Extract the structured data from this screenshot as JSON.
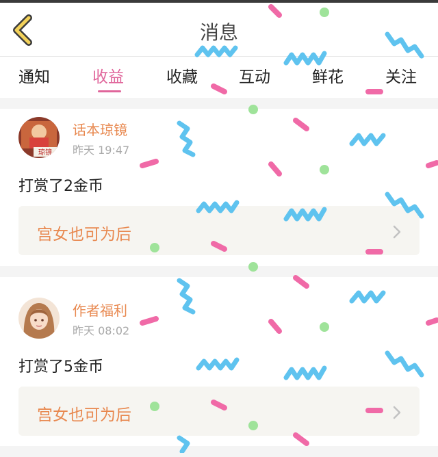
{
  "header": {
    "title": "消息"
  },
  "tabs": [
    {
      "label": "通知",
      "active": false
    },
    {
      "label": "收益",
      "active": true
    },
    {
      "label": "收藏",
      "active": false
    },
    {
      "label": "互动",
      "active": false
    },
    {
      "label": "鲜花",
      "active": false
    },
    {
      "label": "关注",
      "active": false
    }
  ],
  "messages": [
    {
      "sender": "话本琼镜",
      "time": "昨天 19:47",
      "action": "打赏了2金币",
      "book_title": "宫女也可为后",
      "avatar_text": "琼镜"
    },
    {
      "sender": "作者福利",
      "time": "昨天 08:02",
      "action": "打赏了5金币",
      "book_title": "宫女也可为后"
    }
  ],
  "colors": {
    "accent": "#e0669b",
    "sender": "#e8884f",
    "confetti_blue": "#5fc3ef",
    "confetti_pink": "#f06aa7",
    "confetti_green": "#9fe39a"
  }
}
